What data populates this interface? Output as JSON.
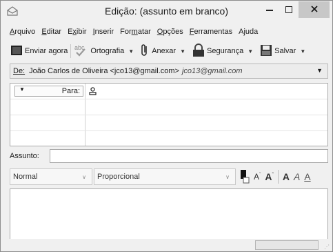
{
  "window": {
    "title": "Edição: (assunto em branco)"
  },
  "menu": {
    "items": [
      {
        "label": "Arquivo",
        "ul": "A",
        "rest": "rquivo"
      },
      {
        "label": "Editar",
        "ul": "E",
        "rest": "ditar"
      },
      {
        "label": "Exibir",
        "pre": "E",
        "ul": "x",
        "rest": "ibir"
      },
      {
        "label": "Inserir",
        "ul": "I",
        "rest": "nserir"
      },
      {
        "label": "Formatar",
        "pre": "For",
        "ul": "m",
        "rest": "atar"
      },
      {
        "label": "Opções",
        "ul": "O",
        "rest": "pções"
      },
      {
        "label": "Ferramentas",
        "ul": "F",
        "rest": "erramentas"
      },
      {
        "label": "Ajuda",
        "pre": "A",
        "ul": "j",
        "rest": "uda"
      }
    ]
  },
  "toolbar": {
    "send_label": "Enviar agora",
    "spell_label": "Ortografia",
    "attach_label": "Anexar",
    "security_label": "Segurança",
    "save_label": "Salvar"
  },
  "from": {
    "label": "De:",
    "value": "João Carlos de Oliveira <jco13@gmail.com>",
    "account": "jco13@gmail.com"
  },
  "recipients": {
    "rows": [
      {
        "type": "Para:"
      }
    ]
  },
  "subject": {
    "label": "Assunto:",
    "value": ""
  },
  "format": {
    "paragraph": "Normal",
    "font": "Proporcional"
  },
  "colors": {
    "close_button": "#c7c7c7",
    "window_bg": "#f0f0f0"
  }
}
